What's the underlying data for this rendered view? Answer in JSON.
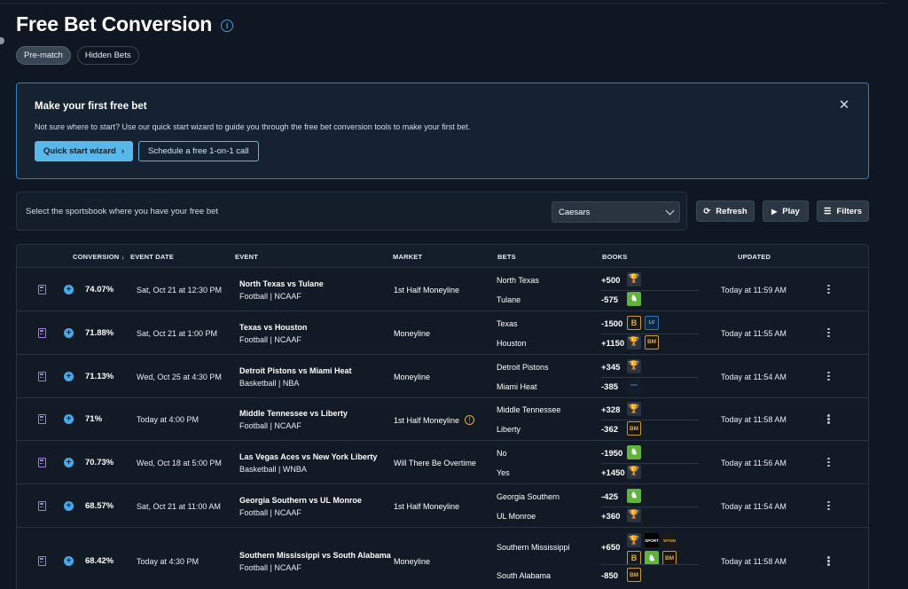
{
  "page": {
    "title": "Free Bet Conversion",
    "tabs": [
      "Pre-match",
      "Hidden Bets"
    ]
  },
  "banner": {
    "title": "Make your first free bet",
    "text": "Not sure where to start? Use our quick start wizard to guide you through the free bet conversion tools to make your first bet.",
    "primary_button": "Quick start wizard",
    "secondary_button": "Schedule a free 1-on-1 call"
  },
  "selector": {
    "label": "Select the sportsbook where you have your free bet",
    "value": "Caesars"
  },
  "toolbar": {
    "refresh": "Refresh",
    "play": "Play",
    "filters": "Filters"
  },
  "table": {
    "headers": {
      "conversion": "CONVERSION",
      "event_date": "EVENT DATE",
      "event": "EVENT",
      "market": "MARKET",
      "bets": "BETS",
      "books": "BOOKS",
      "updated": "UPDATED"
    },
    "rows": [
      {
        "conversion": "74.07%",
        "date": "Sat, Oct 21 at 12:30 PM",
        "event": "North Texas vs Tulane",
        "league": "Football | NCAAF",
        "market": "1st Half Moneyline",
        "bets": [
          {
            "name": "North Texas",
            "odds": "+500",
            "books": [
              "trophy"
            ]
          },
          {
            "name": "Tulane",
            "odds": "-575",
            "books": [
              "draftkings"
            ]
          }
        ],
        "updated": "Today at 11:59 AM"
      },
      {
        "conversion": "71.88%",
        "date": "Sat, Oct 21 at 1:00 PM",
        "event": "Texas vs Houston",
        "league": "Football | NCAAF",
        "market": "Moneyline",
        "bets": [
          {
            "name": "Texas",
            "odds": "-1500",
            "books": [
              "betmgm-b",
              "lv"
            ]
          },
          {
            "name": "Houston",
            "odds": "+1150",
            "books": [
              "trophy",
              "bm"
            ]
          }
        ],
        "updated": "Today at 11:55 AM"
      },
      {
        "conversion": "71.13%",
        "date": "Wed, Oct 25 at 4:30 PM",
        "event": "Detroit Pistons vs Miami Heat",
        "league": "Basketball | NBA",
        "market": "Moneyline",
        "bets": [
          {
            "name": "Detroit Pistons",
            "odds": "+345",
            "books": [
              "trophy"
            ]
          },
          {
            "name": "Miami Heat",
            "odds": "-385",
            "books": [
              "line"
            ]
          }
        ],
        "updated": "Today at 11:54 AM"
      },
      {
        "conversion": "71%",
        "date": "Today at 4:00 PM",
        "event": "Middle Tennessee vs Liberty",
        "league": "Football | NCAAF",
        "market": "1st Half Moneyline",
        "warning": true,
        "bets": [
          {
            "name": "Middle Tennessee",
            "odds": "+328",
            "books": [
              "trophy"
            ]
          },
          {
            "name": "Liberty",
            "odds": "-362",
            "books": [
              "bm"
            ]
          }
        ],
        "updated": "Today at 11:58 AM"
      },
      {
        "conversion": "70.73%",
        "date": "Wed, Oct 18 at 5:00 PM",
        "event": "Las Vegas Aces vs New York Liberty",
        "league": "Basketball | WNBA",
        "market": "Will There Be Overtime",
        "bets": [
          {
            "name": "No",
            "odds": "-1950",
            "books": [
              "draftkings"
            ]
          },
          {
            "name": "Yes",
            "odds": "+1450",
            "books": [
              "trophy"
            ]
          }
        ],
        "updated": "Today at 11:56 AM"
      },
      {
        "conversion": "68.57%",
        "date": "Sat, Oct 21 at 11:00 AM",
        "event": "Georgia Southern vs UL Monroe",
        "league": "Football | NCAAF",
        "market": "1st Half Moneyline",
        "bets": [
          {
            "name": "Georgia Southern",
            "odds": "-425",
            "books": [
              "draftkings"
            ]
          },
          {
            "name": "UL Monroe",
            "odds": "+360",
            "books": [
              "trophy"
            ]
          }
        ],
        "updated": "Today at 11:54 AM"
      },
      {
        "conversion": "68.42%",
        "date": "Today at 4:30 PM",
        "event": "Southern Mississippi vs South Alabama",
        "league": "Football | NCAAF",
        "market": "Moneyline",
        "bets": [
          {
            "name": "Southern Mississippi",
            "odds": "+650",
            "books": [
              "trophy",
              "sportsbook",
              "wynn",
              "betmgm-b",
              "draftkings",
              "bm-round"
            ]
          },
          {
            "name": "South Alabama",
            "odds": "-850",
            "books": [
              "bm"
            ]
          }
        ],
        "updated": "Today at 11:58 AM"
      }
    ]
  }
}
